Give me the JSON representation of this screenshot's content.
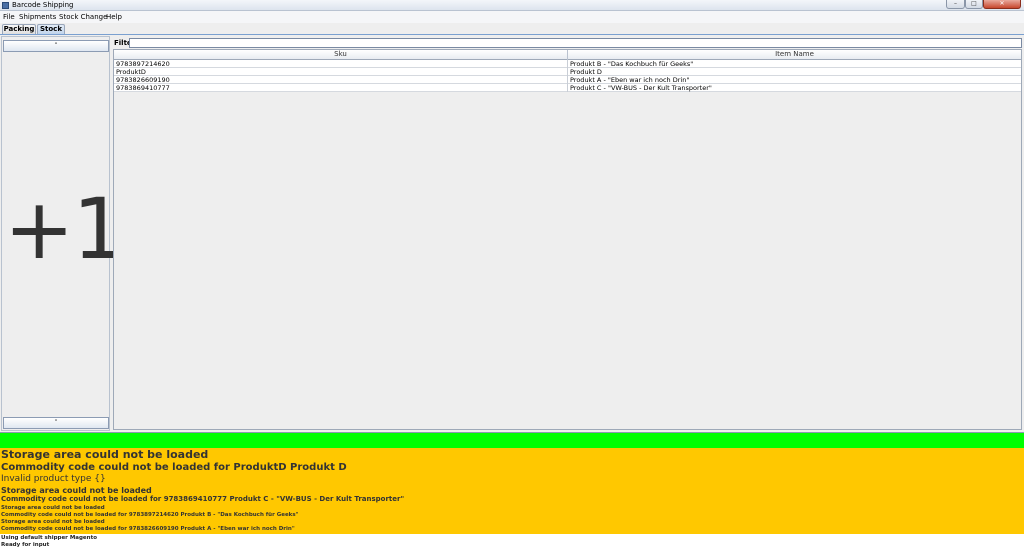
{
  "window": {
    "title": "Barcode Shipping",
    "min_glyph": "–",
    "max_glyph": "□",
    "close_glyph": "✕"
  },
  "menu": [
    "File",
    "Shipments",
    "Stock Change",
    "Help"
  ],
  "tabs": [
    {
      "label": "Packing",
      "active": false
    },
    {
      "label": "Stock",
      "active": true
    }
  ],
  "left_panel": {
    "up_glyph": "˄",
    "down_glyph": "˅",
    "counter": "+1"
  },
  "filter": {
    "label": "Filter",
    "value": ""
  },
  "table": {
    "columns": [
      "Sku",
      "Item Name"
    ],
    "rows": [
      [
        "9783897214620",
        "Produkt B - \"Das Kochbuch für Geeks\""
      ],
      [
        "ProduktD",
        "Produkt D"
      ],
      [
        "9783826609190",
        "Produkt A - \"Eben war ich noch Drin\""
      ],
      [
        "9783869410777",
        "Produkt C - \"VW-BUS - Der Kult Transporter\""
      ]
    ]
  },
  "colors": {
    "status_ok": "#00ff00",
    "log_warning": "#ffc800"
  },
  "log": [
    "Storage area could not be loaded",
    "Commodity code could not be loaded for ProduktD Produkt D",
    "Invalid product type {}",
    "Storage area could not be loaded",
    "Commodity code could not be loaded for 9783869410777 Produkt C - \"VW-BUS - Der Kult Transporter\"",
    "Storage area could not be loaded",
    "Commodity code could not be loaded for 9783897214620 Produkt B - \"Das Kochbuch für Geeks\"",
    "Storage area could not be loaded",
    "Commodity code could not be loaded for 9783826609190 Produkt A - \"Eben war ich noch Drin\""
  ],
  "status": [
    "Using default shipper Magento",
    "Ready for input"
  ]
}
